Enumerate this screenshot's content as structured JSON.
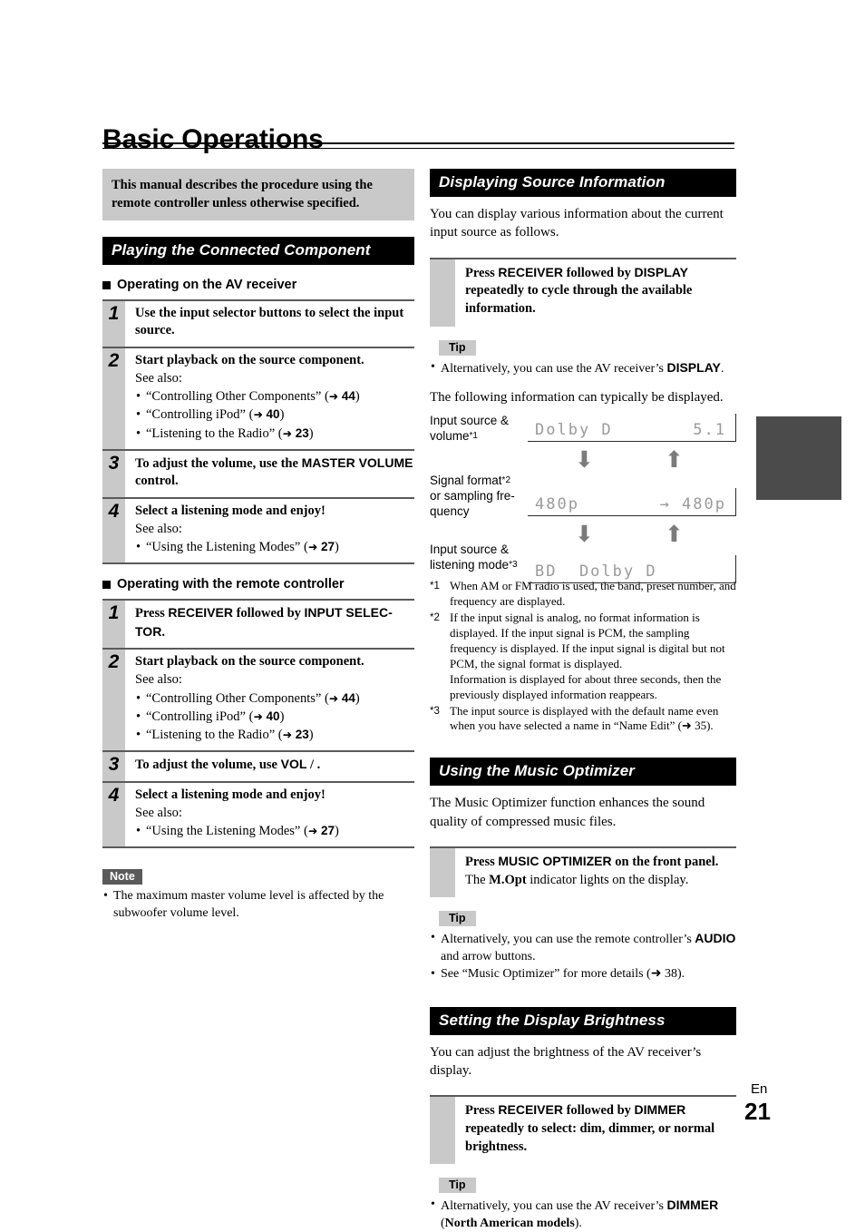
{
  "document": {
    "title": "Basic Operations",
    "footer_lang": "En",
    "footer_page": "21"
  },
  "intro_note": "This manual describes the procedure using the remote controller unless otherwise specified.",
  "left_column": {
    "section_title": "Playing the Connected Component",
    "subsection_av": {
      "heading": "Operating on the AV receiver",
      "steps": [
        {
          "num": "1",
          "title_pre": "Use the input selector buttons to select the input source.",
          "see_also": "",
          "bullets": []
        },
        {
          "num": "2",
          "title_pre": "Start playback on the source component.",
          "see_also": "See also:",
          "bullets": [
            {
              "text": "“Controlling Other Components”",
              "page": "44"
            },
            {
              "text": "“Controlling iPod”",
              "page": "40"
            },
            {
              "text": "“Listening to the Radio”",
              "page": "23"
            }
          ]
        },
        {
          "num": "3",
          "title_pre": "To adjust the volume, use the ",
          "title_bold": "MASTER VOLUME",
          "title_post": " control.",
          "see_also": "",
          "bullets": []
        },
        {
          "num": "4",
          "title_pre": "Select a listening mode and enjoy!",
          "see_also": "See also:",
          "bullets": [
            {
              "text": "“Using the Listening Modes”",
              "page": "27"
            }
          ]
        }
      ]
    },
    "subsection_remote": {
      "heading": "Operating with the remote controller",
      "steps": [
        {
          "num": "1",
          "title_pre": "Press ",
          "title_bold": "RECEIVER",
          "title_mid": " followed by ",
          "title_bold2": "INPUT SELEC-TOR",
          "title_post": ".",
          "see_also": "",
          "bullets": []
        },
        {
          "num": "2",
          "title_pre": "Start playback on the source component.",
          "see_also": "See also:",
          "bullets": [
            {
              "text": "“Controlling Other Components”",
              "page": "44"
            },
            {
              "text": "“Controlling iPod”",
              "page": "40"
            },
            {
              "text": "“Listening to the Radio”",
              "page": "23"
            }
          ]
        },
        {
          "num": "3",
          "title_pre": "To adjust the volume, use ",
          "title_bold": "VOL",
          "title_post": "   /  .",
          "see_also": "",
          "bullets": []
        },
        {
          "num": "4",
          "title_pre": "Select a listening mode and enjoy!",
          "see_also": "See also:",
          "bullets": [
            {
              "text": "“Using the Listening Modes”",
              "page": "27"
            }
          ]
        }
      ]
    },
    "note": {
      "label": "Note",
      "text": "The maximum master volume level is affected by the subwoofer volume level."
    }
  },
  "right_column": {
    "section_display_info": {
      "title": "Displaying Source Information",
      "intro": "You can display various information about the current input source as follows.",
      "action": {
        "pre": "Press ",
        "bold1": "RECEIVER",
        "mid": " followed by ",
        "bold2": "DISPLAY",
        "post": " repeatedly to cycle through the available information."
      },
      "tip": {
        "label": "Tip",
        "pre": "Alternatively, you can use the AV receiver’s ",
        "bold": "DISPLAY",
        "post": "."
      },
      "lead": "The following information can typically be displayed.",
      "diagram": {
        "rows": [
          {
            "caption_line1": "Input source &",
            "caption_line2": "volume",
            "caption_sup": "*1",
            "lcd_left": "Dolby D",
            "lcd_right": "5.1"
          },
          {
            "caption_line1": "Signal format",
            "caption_sup": "*2",
            "caption_line2": "or sampling fre-",
            "caption_line3": "quency",
            "lcd_left": "480p",
            "lcd_right": "→ 480p"
          },
          {
            "caption_line1": "Input source &",
            "caption_line2": "listening mode",
            "caption_sup": "*3",
            "lcd_left": "BD  Dolby D",
            "lcd_right": ""
          }
        ],
        "arrow_down": "⬇",
        "arrow_up": "⬆"
      },
      "footnotes": [
        {
          "mark": "*1",
          "paragraphs": [
            "When AM or FM radio is used, the band, preset number, and frequency are displayed."
          ]
        },
        {
          "mark": "*2",
          "paragraphs": [
            "If the input signal is analog, no format information is displayed. If the input signal is PCM, the sampling frequency is displayed. If the input signal is digital but not PCM, the signal format is displayed.",
            "Information is displayed for about three seconds, then the previously displayed information reappears."
          ]
        },
        {
          "mark": "*3",
          "paragraphs_with_ref": {
            "pre": "The input source is displayed with the default name even when you have selected a name in “Name Edit” (",
            "page": "35",
            "post": ")."
          }
        }
      ]
    },
    "section_music_optimizer": {
      "title": "Using the Music Optimizer",
      "intro": "The Music Optimizer function enhances the sound quality of compressed music files.",
      "action": {
        "pre": "Press ",
        "bold1": "MUSIC OPTIMIZER",
        "post": " on the front panel.",
        "sub_pre": "The ",
        "sub_bold": "M.Opt",
        "sub_post": " indicator lights on the display."
      },
      "tip": {
        "label": "Tip",
        "bullet1_pre": "Alternatively, you can use the remote controller’s ",
        "bullet1_bold": "AUDIO",
        "bullet1_post": " and arrow buttons.",
        "bullet2_pre": "See “Music Optimizer” for more details (",
        "bullet2_page": "38",
        "bullet2_post": ")."
      }
    },
    "section_display_brightness": {
      "title": "Setting the Display Brightness",
      "intro": "You can adjust the brightness of the AV receiver’s display.",
      "action": {
        "pre": "Press ",
        "bold1": "RECEIVER",
        "mid": " followed by ",
        "bold2": "DIMMER",
        "post": " repeatedly to select: dim, dimmer, or normal brightness."
      },
      "tip": {
        "label": "Tip",
        "pre": "Alternatively, you can use the AV receiver’s ",
        "bold": "DIMMER",
        "mid": " (",
        "bold2": "North American models",
        "post": ")."
      }
    }
  },
  "colors": {
    "section_bar_bg": "#000000",
    "gray_panel": "#c9c9c9",
    "note_label_bg": "#5a5a5a",
    "thumb_tab": "#4b4b4b",
    "lcd_text": "#9a9a9a"
  }
}
